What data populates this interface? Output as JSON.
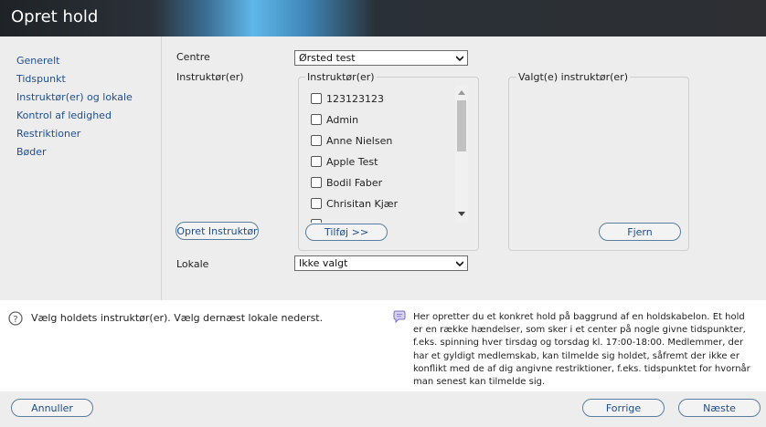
{
  "window": {
    "title": "Opret hold"
  },
  "sidebar": {
    "items": [
      {
        "label": "Generelt"
      },
      {
        "label": "Tidspunkt"
      },
      {
        "label": "Instruktør(er) og lokale"
      },
      {
        "label": "Kontrol af ledighed"
      },
      {
        "label": "Restriktioner"
      },
      {
        "label": "Bøder"
      }
    ]
  },
  "form": {
    "centre_label": "Centre",
    "centre_value": "Ørsted test",
    "instructors_label": "Instruktør(er)",
    "instructors_group_legend": "Instruktør(er)",
    "instructors": [
      {
        "name": "123123123",
        "checked": false
      },
      {
        "name": "Admin",
        "checked": false
      },
      {
        "name": "Anne Nielsen",
        "checked": false
      },
      {
        "name": "Apple Test",
        "checked": false
      },
      {
        "name": "Bodil Faber",
        "checked": false
      },
      {
        "name": "Chrisitan Kjær",
        "checked": false
      }
    ],
    "add_button": "Tilføj >>",
    "create_instructor_button": "Opret Instruktør",
    "selected_group_legend": "Valgt(e) instruktør(er)",
    "remove_button": "Fjern",
    "location_label": "Lokale",
    "location_value": "Ikke valgt"
  },
  "help": {
    "hint": "Vælg holdets instruktør(er). Vælg dernæst lokale nederst.",
    "info": "Her opretter du et konkret hold på baggrund af en holdskabelon. Et hold er en række hændelser, som sker i et center på nogle givne tidspunkter, f.eks. spinning hver tirsdag og torsdag kl. 17:00-18:00. Medlemmer, der har et gyldigt medlemskab, kan tilmelde sig holdet, såfremt der ikke er konflikt med de af dig angivne restriktioner, f.eks. tidspunktet for hvornår man senest kan tilmelde sig."
  },
  "footer": {
    "cancel": "Annuller",
    "previous": "Forrige",
    "next": "Næste"
  }
}
